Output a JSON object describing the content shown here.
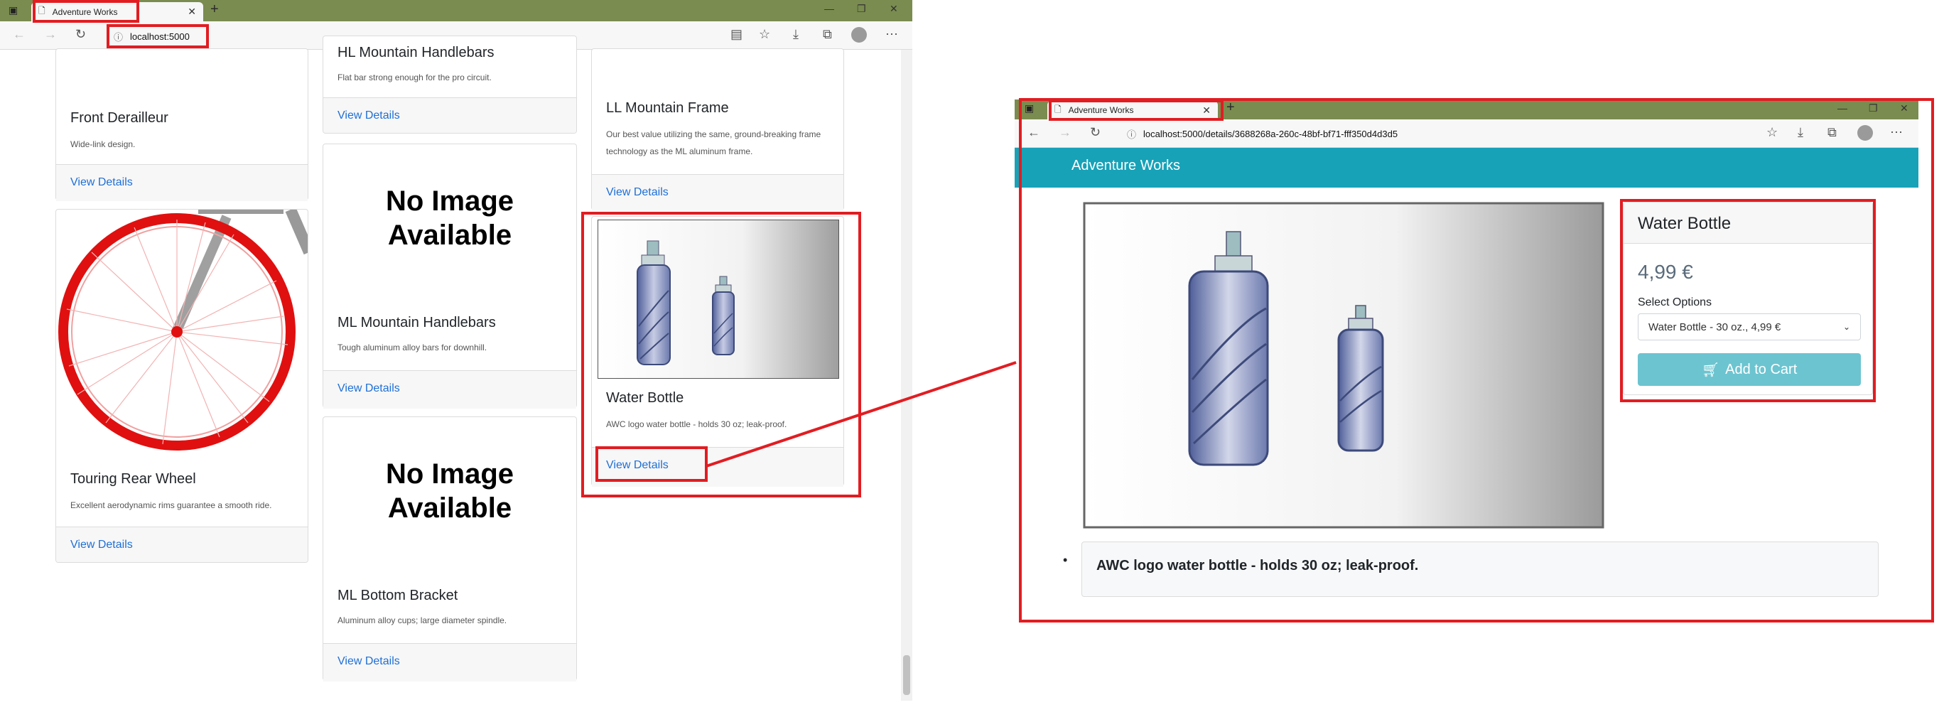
{
  "left_browser": {
    "tab_title": "Adventure Works",
    "url": "localhost:5000"
  },
  "product_list": {
    "col1": [
      {
        "title": "Front Derailleur",
        "desc": "Wide-link design.",
        "link": "View Details"
      },
      {
        "title": "Touring Rear Wheel",
        "desc": "Excellent aerodynamic rims guarantee a smooth ride.",
        "link": "View Details"
      }
    ],
    "col2": [
      {
        "title": "HL Mountain Handlebars",
        "desc": "Flat bar strong enough for the pro circuit.",
        "link": "View Details"
      },
      {
        "image_text": "No Image Available",
        "title": "ML Mountain Handlebars",
        "desc": "Tough aluminum alloy bars for downhill.",
        "link": "View Details"
      },
      {
        "image_text": "No Image Available",
        "title": "ML Bottom Bracket",
        "desc": "Aluminum alloy cups; large diameter spindle.",
        "link": "View Details"
      }
    ],
    "col3": [
      {
        "title": "LL Mountain Frame",
        "desc": "Our best value utilizing the same, ground-breaking frame technology as the ML aluminum frame.",
        "link": "View Details"
      },
      {
        "title": "Water Bottle",
        "desc": "AWC logo water bottle - holds 30 oz; leak-proof.",
        "link": "View Details"
      }
    ]
  },
  "right_browser": {
    "tab_title": "Adventure Works",
    "url": "localhost:5000/details/3688268a-260c-48bf-bf71-fff350d4d3d5",
    "brand": "Adventure Works",
    "product": {
      "name": "Water Bottle",
      "price": "4,99 €",
      "options_label": "Select Options",
      "selected_option": "Water Bottle - 30 oz., 4,99 €",
      "cart_button": "Add to Cart",
      "feature": "AWC logo water bottle - holds 30 oz; leak-proof."
    }
  },
  "colors": {
    "highlight": "#e11d22",
    "navbar": "#17a2b8",
    "link": "#1e6fd6",
    "tabbar": "#7a8c4f"
  }
}
